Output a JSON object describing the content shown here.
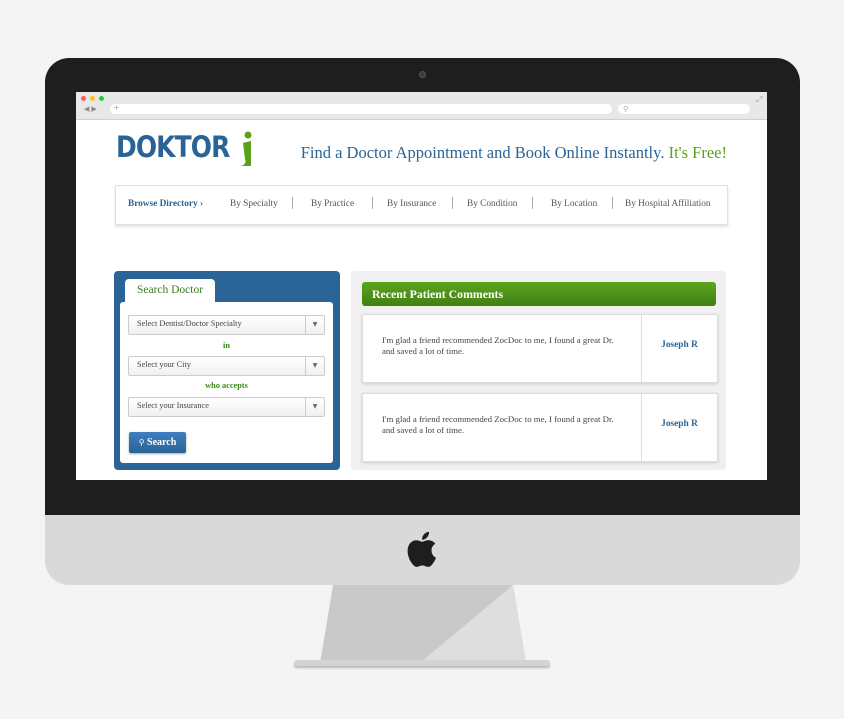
{
  "brand": {
    "logo_text": "DOKTOR",
    "tagline_main": "Find a Doctor Appointment and Book Online Instantly.",
    "tagline_free": "It's Free!",
    "primary_color": "#2a6496",
    "accent_color": "#5aa11a"
  },
  "browser": {
    "url_placeholder": "+",
    "traffic_lights": [
      "#ff5f57",
      "#ffbd2e",
      "#28c840"
    ]
  },
  "nav": {
    "browse_label": "Browse Directory",
    "browse_arrow": "›",
    "items": [
      {
        "label": "By Specialty"
      },
      {
        "label": "By Practice"
      },
      {
        "label": "By Insurance"
      },
      {
        "label": "By Condition"
      },
      {
        "label": "By Location"
      },
      {
        "label": "By Hospital Affiliation"
      }
    ]
  },
  "search": {
    "tab_label": "Search Doctor",
    "specialty_select": "Select Dentist/Doctor Specialty",
    "connector_in": "in",
    "city_select": "Select your City",
    "connector_accepts": "who accepts",
    "insurance_select": "Select your Insurance",
    "button_label": "Search",
    "button_icon": "search-icon"
  },
  "comments": {
    "header": "Recent Patient Comments",
    "items": [
      {
        "text": "I'm glad a friend recommended ZocDoc to me, I found a great Dr. and saved a lot of time.",
        "author": "Joseph R"
      },
      {
        "text": "I'm glad a friend recommended ZocDoc to me, I found a great Dr. and saved a lot of time.",
        "author": "Joseph R"
      }
    ]
  }
}
